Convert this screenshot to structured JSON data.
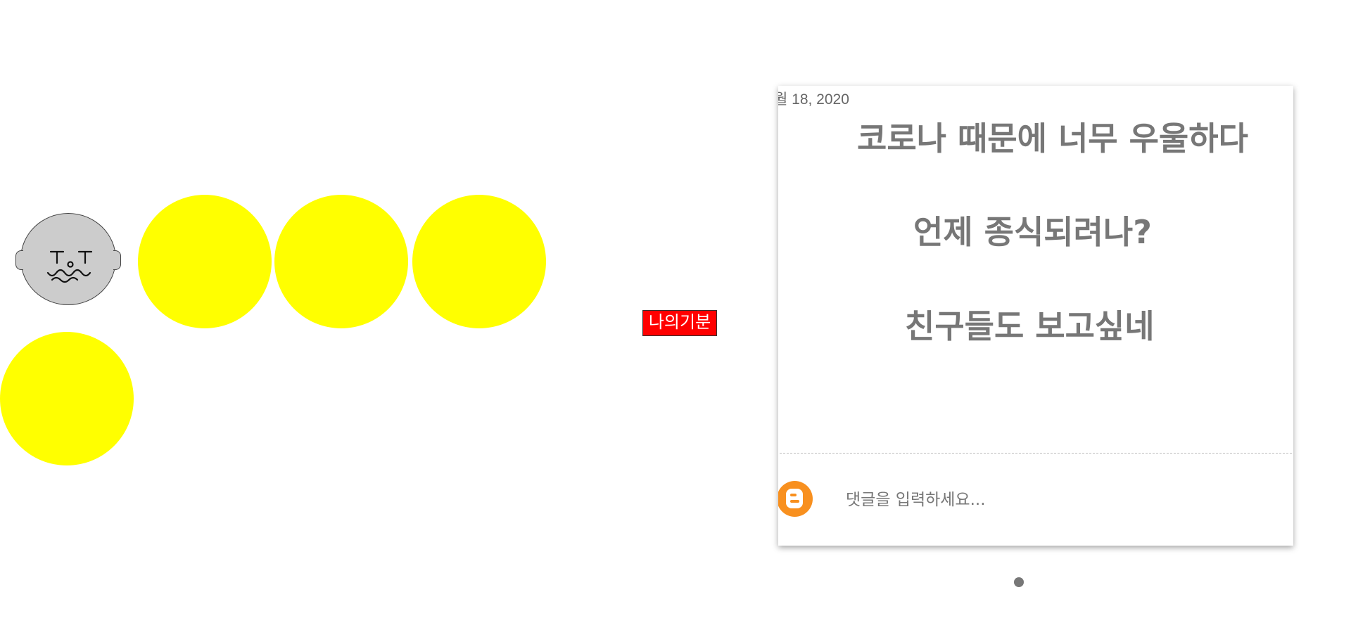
{
  "mood": {
    "label": "나의기분",
    "face_icon": "sad-face-icon",
    "circle_color": "#ffff00",
    "label_color": "#ff0000"
  },
  "post": {
    "date": "월 18, 2020",
    "lines": [
      "코로나 때문에 너무 우울하다",
      "언제 종식되려나?",
      "친구들도 보고싶네"
    ],
    "text_color": "#777777"
  },
  "comment": {
    "placeholder": "댓글을 입력하세요...",
    "avatar_icon": "blogger-icon",
    "accent": "#f8901f"
  },
  "pager": {
    "dot_icon": "page-indicator-dot"
  }
}
